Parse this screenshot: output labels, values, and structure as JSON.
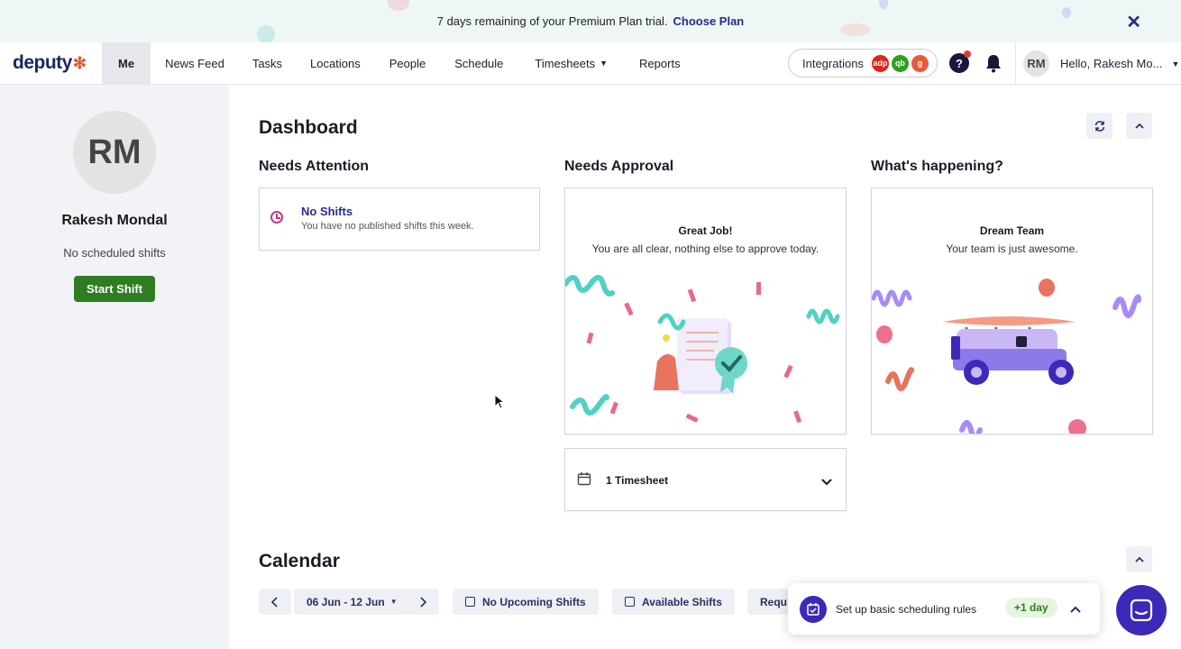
{
  "banner": {
    "text": "7 days remaining of your Premium Plan trial.",
    "link": "Choose Plan",
    "close": "✕"
  },
  "nav": {
    "logo": "deputy",
    "items": [
      {
        "label": "Me"
      },
      {
        "label": "News Feed"
      },
      {
        "label": "Tasks"
      },
      {
        "label": "Locations"
      },
      {
        "label": "People"
      },
      {
        "label": "Schedule"
      },
      {
        "label": "Timesheets"
      },
      {
        "label": "Reports"
      }
    ],
    "integrations": "Integrations",
    "integration_logos": [
      "adp",
      "qb",
      "g"
    ],
    "help": "?",
    "user_initials": "RM",
    "user_greeting": "Hello, Rakesh Mo..."
  },
  "sidebar": {
    "initials": "RM",
    "name": "Rakesh Mondal",
    "status": "No scheduled shifts",
    "start_button": "Start Shift"
  },
  "dashboard": {
    "title": "Dashboard",
    "needs_attention": {
      "title": "Needs Attention",
      "item_title": "No Shifts",
      "item_sub": "You have no published shifts this week."
    },
    "needs_approval": {
      "title": "Needs Approval",
      "card_title": "Great Job!",
      "card_msg": "You are all clear, nothing else to approve today.",
      "timesheet_label": "1 Timesheet"
    },
    "whats_happening": {
      "title": "What's happening?",
      "card_title": "Dream Team",
      "card_msg": "Your team is just awesome."
    }
  },
  "calendar": {
    "title": "Calendar",
    "range": "06 Jun - 12 Jun",
    "buttons": [
      "No Upcoming Shifts",
      "Available Shifts",
      "Requ"
    ]
  },
  "toast": {
    "text": "Set up basic scheduling rules",
    "badge": "+1 day"
  },
  "colors": {
    "brand_navy": "#1c2566",
    "primary_purple": "#3b2ab8",
    "start_green": "#2e7d22",
    "accent_pink": "#c33b8e"
  }
}
